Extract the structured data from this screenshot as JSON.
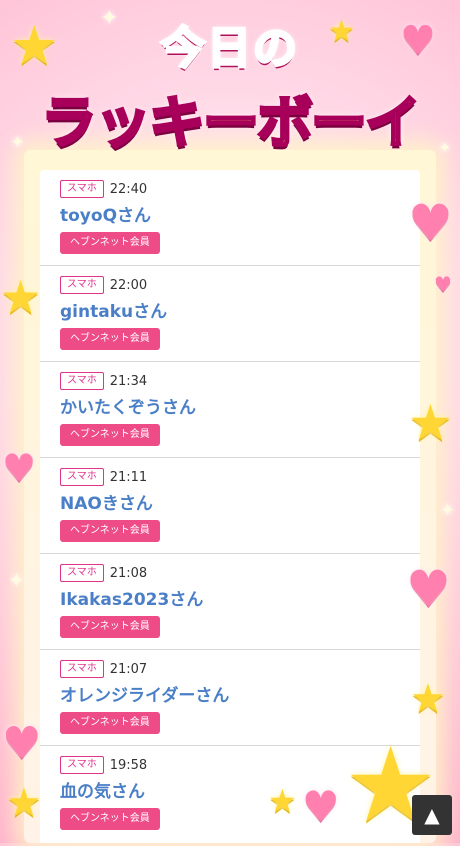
{
  "header": {
    "title_line1": "今日の",
    "title_line2": "ラッキーボーイ"
  },
  "entries": [
    {
      "device": "スマホ",
      "time": "22:40",
      "name": "toyoQさん",
      "badge": "ヘブンネット会員"
    },
    {
      "device": "スマホ",
      "time": "22:00",
      "name": "gintakuさん",
      "badge": "ヘブンネット会員"
    },
    {
      "device": "スマホ",
      "time": "21:34",
      "name": "かいたくぞうさん",
      "badge": "ヘブンネット会員"
    },
    {
      "device": "スマホ",
      "time": "21:11",
      "name": "NAOきさん",
      "badge": "ヘブンネット会員"
    },
    {
      "device": "スマホ",
      "time": "21:08",
      "name": "Ikakas2023さん",
      "badge": "ヘブンネット会員"
    },
    {
      "device": "スマホ",
      "time": "21:07",
      "name": "オレンジライダーさん",
      "badge": "ヘブンネット会員"
    },
    {
      "device": "スマホ",
      "time": "19:58",
      "name": "血の気さん",
      "badge": "ヘブンネット会員"
    }
  ],
  "scroll_top_button": {
    "icon": "triangle-up-icon",
    "glyph": "▲"
  },
  "colors": {
    "accent": "#ee4c86",
    "name_link": "#4a7fc7",
    "title_pink": "#ff4f9a",
    "title_yellow": "#ffe860"
  }
}
